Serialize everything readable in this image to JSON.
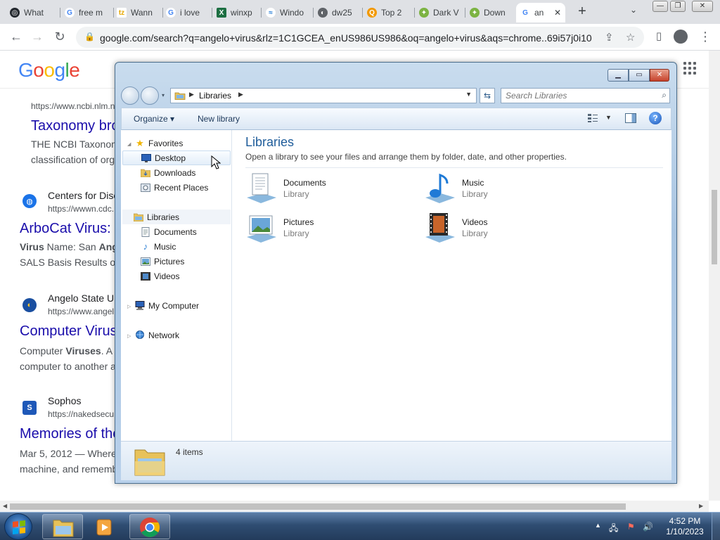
{
  "browser": {
    "tabs": [
      {
        "label": "What",
        "fav": "github",
        "color": "#24292f",
        "letter": "◎"
      },
      {
        "label": "free m",
        "fav": "google",
        "color": "#4285f4",
        "letter": "G"
      },
      {
        "label": "Wann",
        "fav": "tz",
        "color": "#e6a700",
        "letter": "tz"
      },
      {
        "label": "i love",
        "fav": "google",
        "color": "#4285f4",
        "letter": "G"
      },
      {
        "label": "winxp",
        "fav": "excel",
        "color": "#1d6f42",
        "letter": "X"
      },
      {
        "label": "Windo",
        "fav": "windows",
        "color": "#1f7ad6",
        "letter": "≈"
      },
      {
        "label": "dw25",
        "fav": "globe",
        "color": "#5f6368",
        "letter": "◐"
      },
      {
        "label": "Top 2",
        "fav": "search",
        "color": "#f29900",
        "letter": "Q"
      },
      {
        "label": "Dark V",
        "fav": "android",
        "color": "#7cb342",
        "letter": "✦"
      },
      {
        "label": "Down",
        "fav": "android",
        "color": "#7cb342",
        "letter": "✦"
      },
      {
        "label": "an",
        "fav": "google",
        "color": "#4285f4",
        "letter": "G"
      }
    ],
    "new_tab": "+",
    "url": "google.com/search?q=angelo+virus&rlz=1C1GCEA_enUS986US986&oq=angelo+virus&aqs=chrome..69i57j0i10..."
  },
  "google": {
    "logo": "Google",
    "results": [
      {
        "site": "",
        "url": "https://www.ncbi.nlm.n",
        "title": "Taxonomy bro",
        "snippet": [
          "THE NCBI Taxonon",
          "classification of org"
        ],
        "icon_color": "",
        "icon": ""
      },
      {
        "site": "Centers for Dise",
        "url": "https://wwwn.cdc.",
        "title": "ArboCat Virus:",
        "snippet_bold": [
          "Virus",
          "Ang"
        ],
        "snippet": [
          "Name: San ",
          "SALS Basis Results o"
        ],
        "icon_color": "#1a73e8",
        "icon": "globe-icon"
      },
      {
        "site": "Angelo State U",
        "url": "https://www.angel",
        "title": "Computer Virus",
        "snippet_bold": [
          "Viruses"
        ],
        "snippet": [
          "Computer ",
          ". A",
          "computer to another a"
        ],
        "icon_color": "#1a4fa0",
        "icon": "asu-icon"
      },
      {
        "site": "Sophos",
        "url": "https://nakedsecu",
        "title": "Memories of the",
        "snippet": [
          "Mar 5, 2012 — Where",
          "machine, and rememb"
        ],
        "icon_color": "#1e58b8",
        "icon": "sophos-icon",
        "icon_letter": "S"
      }
    ]
  },
  "explorer": {
    "address": "Libraries",
    "search_placeholder": "Search Libraries",
    "commands": {
      "organize": "Organize ▾",
      "new_library": "New library"
    },
    "nav": {
      "favorites": "Favorites",
      "desktop": "Desktop",
      "downloads": "Downloads",
      "recent": "Recent Places",
      "libraries": "Libraries",
      "documents": "Documents",
      "music": "Music",
      "pictures": "Pictures",
      "videos": "Videos",
      "computer": "My Computer",
      "network": "Network"
    },
    "content": {
      "title": "Libraries",
      "description": "Open a library to see your files and arrange them by folder, date, and other properties.",
      "items": [
        {
          "name": "Documents",
          "type": "Library"
        },
        {
          "name": "Music",
          "type": "Library"
        },
        {
          "name": "Pictures",
          "type": "Library"
        },
        {
          "name": "Videos",
          "type": "Library"
        }
      ]
    },
    "status": "4 items"
  },
  "taskbar": {
    "time": "4:52 PM",
    "date": "1/10/2023"
  }
}
